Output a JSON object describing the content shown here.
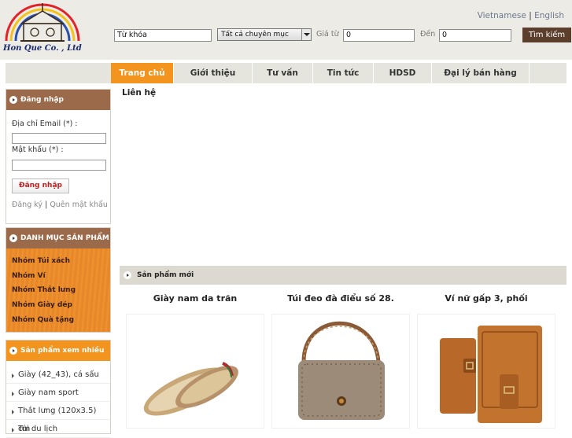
{
  "header": {
    "logo_text": "Hon Que Co. , Ltd",
    "languages": [
      "Vietnamese",
      "English"
    ],
    "lang_sep": "|"
  },
  "search": {
    "keyword_value": "Từ khóa",
    "category_value": "Tất cả chuyên mục",
    "price_from_label": "Giá từ",
    "price_from_value": "0",
    "price_to_label": "Đến",
    "price_to_value": "0",
    "button_label": "Tìm kiếm"
  },
  "nav": {
    "items": [
      "Trang chủ",
      "Giới thiệu",
      "Tư vấn",
      "Tin tức",
      "HDSD",
      "Đại lý bán hàng"
    ],
    "active_index": 0
  },
  "login": {
    "title": "Đăng nhập",
    "email_label": "Địa chỉ Email (*) :",
    "password_label": "Mật khẩu (*) :",
    "button_label": "Đăng nhập",
    "register_label": "Đăng ký",
    "sep": "|",
    "forgot_label": "Quên mật khẩu"
  },
  "categories": {
    "title": "DANH MỤC SẢN PHẨM",
    "items": [
      "Nhóm Túi xách",
      "Nhóm Ví",
      "Nhóm Thắt lưng",
      "Nhóm Giày dép",
      "Nhóm Quà tặng"
    ]
  },
  "most_viewed": {
    "title": "Sản phẩm xem nhiều",
    "items": [
      "Giày (42_43), cá sấu",
      "Giày nam sport",
      "Thắt lưng (120x3.5) cm",
      "Túi du lịch"
    ]
  },
  "main": {
    "page_title": "Liên hệ",
    "new_products_title": "Sản phẩm mới",
    "products": [
      {
        "name": "Giày nam da trăn"
      },
      {
        "name": "Túi đeo đà điểu số 28."
      },
      {
        "name": "Ví nữ gấp 3, phối"
      }
    ]
  },
  "colors": {
    "accent_orange": "#f2941e",
    "brown": "#9b6a4a",
    "search_button": "#5b3e2b"
  }
}
